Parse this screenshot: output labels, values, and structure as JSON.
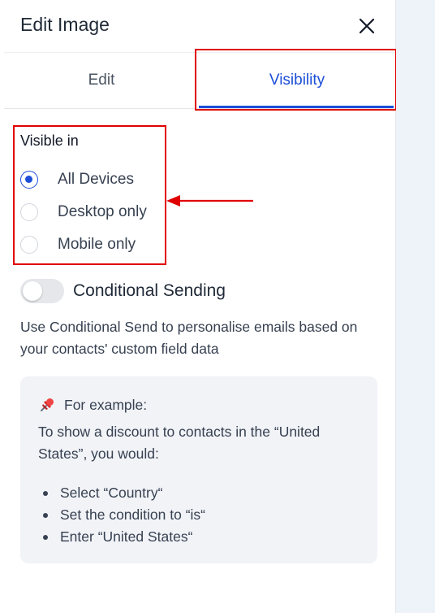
{
  "header": {
    "title": "Edit Image",
    "close_icon": "close-icon"
  },
  "tabs": [
    {
      "label": "Edit",
      "active": false
    },
    {
      "label": "Visibility",
      "active": true
    }
  ],
  "visibility": {
    "section_label": "Visible in",
    "options": [
      {
        "label": "All Devices",
        "checked": true
      },
      {
        "label": "Desktop only",
        "checked": false
      },
      {
        "label": "Mobile only",
        "checked": false
      }
    ]
  },
  "conditional": {
    "toggle_label": "Conditional Sending",
    "toggle_on": false,
    "description": "Use Conditional Send to personalise emails based on your contacts' custom field data"
  },
  "example": {
    "icon": "pushpin-icon",
    "heading": "For example:",
    "intro": "To show a discount to contacts in the “United States”, you would:",
    "steps": [
      "Select “Country“",
      "Set the condition to “is“",
      "Enter “United States“"
    ]
  },
  "colors": {
    "accent": "#1d4ed8",
    "highlight": "#e00000",
    "canvas_bg": "#eef2f9",
    "example_bg": "#f1f3f7"
  }
}
